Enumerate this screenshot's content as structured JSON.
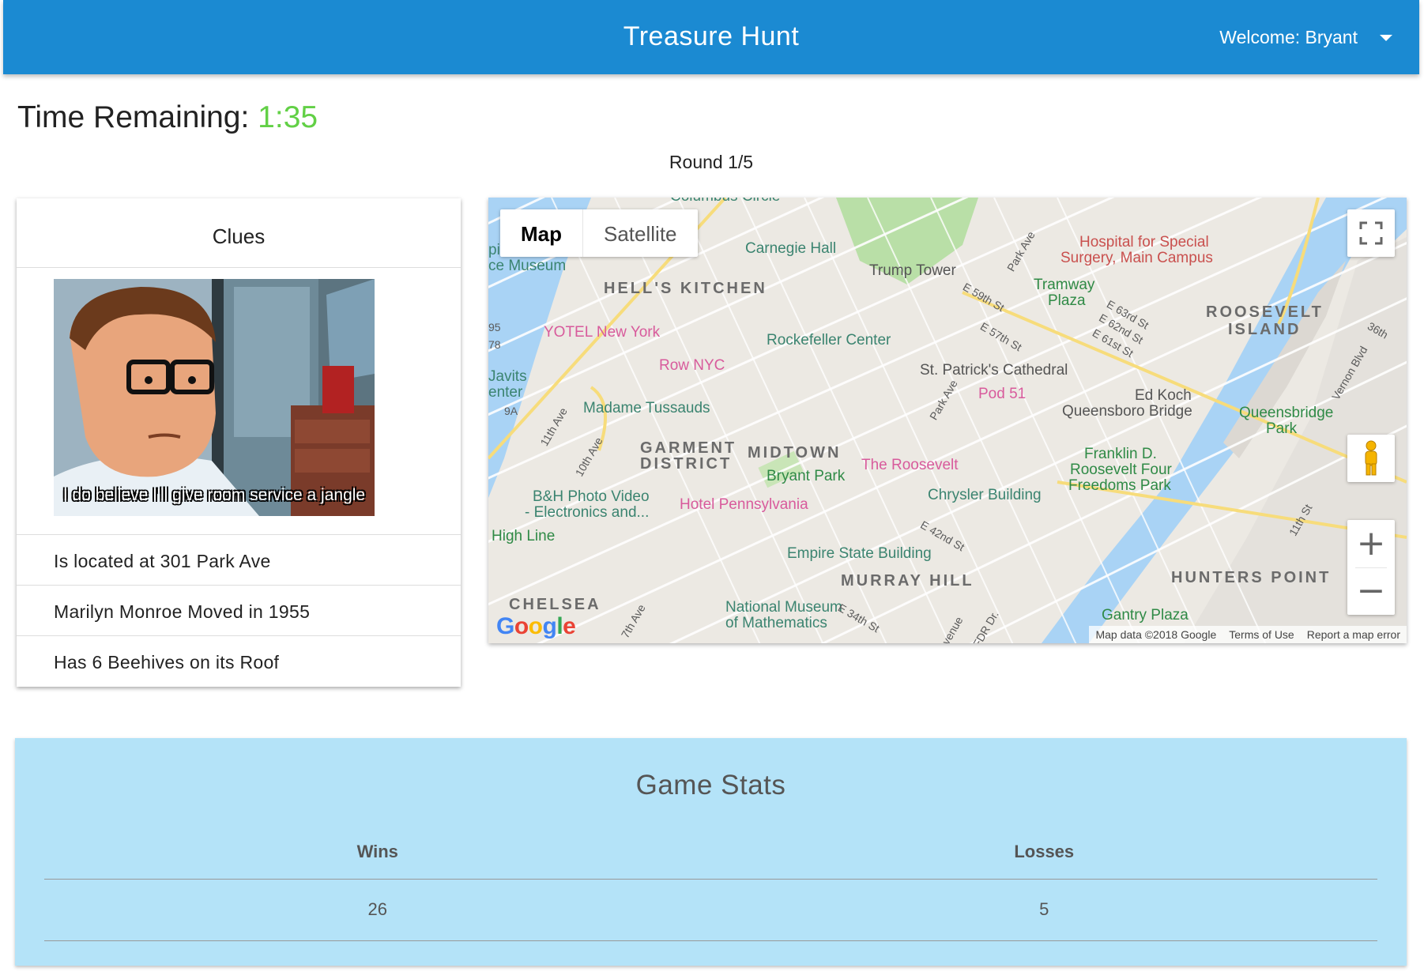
{
  "header": {
    "title": "Treasure Hunt",
    "user_menu_label": "Welcome: Bryant",
    "menu_icon": "caret-down-icon"
  },
  "timer": {
    "label": "Time Remaining:",
    "value": "1:35",
    "value_color": "#62d046"
  },
  "round": "Round 1/5",
  "clues": {
    "title": "Clues",
    "image_caption": "I do believe I'll give room service a jangle",
    "items": [
      "Is located at 301 Park Ave",
      "Marilyn Monroe Moved in 1955",
      "Has 6 Beehives on its Roof"
    ]
  },
  "map": {
    "map_type_buttons": [
      "Map",
      "Satellite"
    ],
    "selected_map_type": "Map",
    "controls": [
      "fullscreen-icon",
      "pegman-icon",
      "zoom-in-icon",
      "zoom-out-icon"
    ],
    "google_logo": "Google",
    "attribution": [
      "Map data ©2018 Google",
      "Terms of Use",
      "Report a map error"
    ],
    "labels": {
      "columbus": "Columbus Circle",
      "carnegie": "Carnegie Hall",
      "trump": "Trump Tower",
      "museum": "ce Museum",
      "museum_top": "pi",
      "hells": "HELL'S KITCHEN",
      "yotel": "YOTEL New York",
      "rownyc": "Row NYC",
      "rockefeller": "Rockefeller Center",
      "stpatrick": "St. Patrick's Cathedral",
      "madame": "Madame Tussauds",
      "javits1": "Javits",
      "javits2": "enter",
      "garment1": "GARMENT",
      "garment2": "DISTRICT",
      "midtown": "MIDTOWN",
      "bryant": "Bryant Park",
      "roosevelt_hotel": "The Roosevelt",
      "chrysler": "Chrysler Building",
      "pod51": "Pod 51",
      "bh1": "B&H Photo Video",
      "bh2": "- Electronics and...",
      "hotelpenn": "Hotel Pennsylvania",
      "highline": "High Line",
      "empire": "Empire State Building",
      "murray": "MURRAY HILL",
      "chelsea": "CHELSEA",
      "natmath1": "National Museum",
      "natmath2": "of Mathematics",
      "hosp1": "Hospital for Special",
      "hosp2": "Surgery, Main Campus",
      "tramway1": "Tramway",
      "tramway2": "Plaza",
      "rooseveltisl1": "ROOSEVELT",
      "rooseveltisl2": "ISLAND",
      "edkoch1": "Ed Koch",
      "edkoch2": "Queensboro Bridge",
      "qbpark1": "Queensbridge",
      "qbpark2": "Park",
      "fdr1": "Franklin D.",
      "fdr2": "Roosevelt Four",
      "fdr3": "Freedoms Park",
      "hunters": "HUNTERS POINT",
      "gantry": "Gantry Plaza",
      "e59": "E 59th St",
      "e57": "E 57th St",
      "e63": "E 63rd St",
      "e62": "E 62nd St",
      "e61": "E 61st St",
      "e42": "E 42nd St",
      "e34": "E 34th St",
      "parkave1": "Park Ave",
      "parkave2": "Park Ave",
      "ave11": "11th Ave",
      "ave10": "10th Ave",
      "ave7": "7th Ave",
      "st36": "36th",
      "vernon": "Vernon Blvd",
      "st11": "11th St",
      "fdr_dr": "FDR Dr.",
      "venue": "venue",
      "r95": "95",
      "r78": "78",
      "r9a": "9A"
    }
  },
  "stats": {
    "title": "Game Stats",
    "columns": [
      "Wins",
      "Losses"
    ],
    "rows": [
      [
        "26",
        "5"
      ]
    ]
  }
}
